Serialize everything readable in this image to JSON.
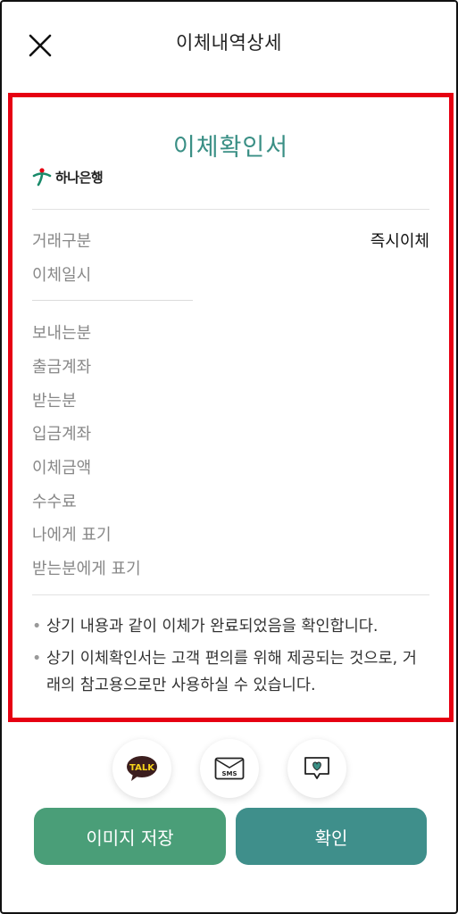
{
  "header": {
    "title": "이체내역상세",
    "close_icon": "close-icon"
  },
  "document": {
    "title": "이체확인서",
    "bank_logo_text": "하나은행",
    "rows_top": [
      {
        "label": "거래구분",
        "value": "즉시이체"
      },
      {
        "label": "이체일시",
        "value": ""
      }
    ],
    "rows_bottom": [
      {
        "label": "보내는분",
        "value": ""
      },
      {
        "label": "출금계좌",
        "value": ""
      },
      {
        "label": "받는분",
        "value": ""
      },
      {
        "label": "입금계좌",
        "value": ""
      },
      {
        "label": "이체금액",
        "value": ""
      },
      {
        "label": "수수료",
        "value": ""
      },
      {
        "label": "나에게 표기",
        "value": ""
      },
      {
        "label": "받는분에게 표기",
        "value": ""
      }
    ],
    "notes": [
      "상기 내용과 같이 이체가 완료되었음을 확인합니다.",
      "상기 이체확인서는 고객 편의를 위해 제공되는 것으로, 거래의 참고용으로만 사용하실 수 있습니다."
    ]
  },
  "share": {
    "talk_label": "TALK",
    "sms_label": "SMS"
  },
  "buttons": {
    "save_label": "이미지 저장",
    "confirm_label": "확인"
  },
  "colors": {
    "accent_teal": "#3a8f85",
    "highlight_red": "#e60012",
    "save_button": "#4a9e78",
    "confirm_button": "#3f8f8b"
  }
}
